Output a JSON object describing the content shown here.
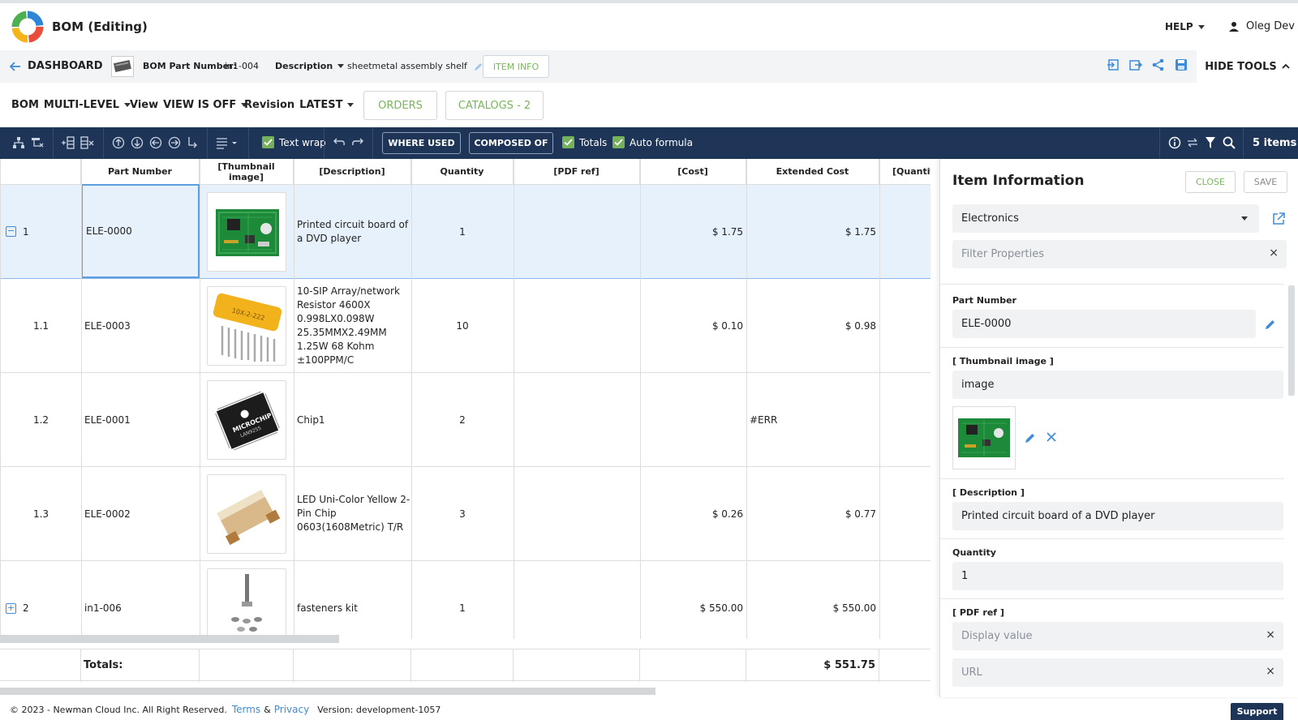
{
  "app": {
    "title": "BOM (Editing)",
    "help_label": "HELP",
    "user_name": "Oleg Dev"
  },
  "nav": {
    "dashboard_label": "DASHBOARD",
    "bom_part_number_label": "BOM Part Number:",
    "bom_part_number_value": "in1-004",
    "description_label": "Description",
    "description_value": "sheetmetal assembly shelf",
    "item_info_label": "ITEM INFO",
    "hide_tools_label": "HIDE TOOLS"
  },
  "options": {
    "bom_label": "BOM",
    "bom_value": "MULTI-LEVEL",
    "view_label": "View",
    "view_value": "VIEW IS OFF",
    "revision_label": "Revision",
    "revision_value": "LATEST",
    "orders_label": "ORDERS",
    "catalogs_label": "CATALOGS - 2"
  },
  "toolbar": {
    "text_wrap_label": "Text wrap",
    "where_used_label": "WHERE USED",
    "composed_of_label": "COMPOSED OF",
    "totals_label": "Totals",
    "auto_formula_label": "Auto formula",
    "items_count": "5 items"
  },
  "table": {
    "columns": [
      "Part Number",
      "[Thumbnail image]",
      "[Description]",
      "Quantity",
      "[PDF ref]",
      "[Cost]",
      "Extended Cost",
      "[Quantity"
    ],
    "rows": [
      {
        "level": "1",
        "expandable": true,
        "part_number": "ELE-0000",
        "description": "Printed circuit board of a DVD player",
        "quantity": "1",
        "pdf_ref": "",
        "cost": "$ 1.75",
        "extended_cost": "$ 1.75",
        "thumb": "pcb"
      },
      {
        "level": "1.1",
        "expandable": false,
        "part_number": "ELE-0003",
        "description": "10-SIP Array/network Resistor 4600X 0.998LX0.098W 25.35MMX2.49MM 1.25W 68 Kohm ±100PPM/C",
        "quantity": "10",
        "pdf_ref": "",
        "cost": "$ 0.10",
        "extended_cost": "$ 0.98",
        "thumb": "resistor"
      },
      {
        "level": "1.2",
        "expandable": false,
        "part_number": "ELE-0001",
        "description": "Chip1",
        "quantity": "2",
        "pdf_ref": "",
        "cost": "",
        "extended_cost": "#ERR",
        "thumb": "chip"
      },
      {
        "level": "1.3",
        "expandable": false,
        "part_number": "ELE-0002",
        "description": "LED Uni-Color Yellow 2-Pin Chip 0603(1608Metric) T/R",
        "quantity": "3",
        "pdf_ref": "",
        "cost": "$ 0.26",
        "extended_cost": "$ 0.77",
        "thumb": "led"
      },
      {
        "level": "2",
        "expandable": true,
        "part_number": "in1-006",
        "description": "fasteners kit",
        "quantity": "1",
        "pdf_ref": "",
        "cost": "$ 550.00",
        "extended_cost": "$ 550.00",
        "thumb": "fasteners"
      }
    ],
    "totals_label": "Totals:",
    "totals_value": "$ 551.75"
  },
  "panel": {
    "title": "Item Information",
    "close_label": "CLOSE",
    "save_label": "SAVE",
    "category_value": "Electronics",
    "filter_placeholder": "Filter Properties",
    "part_number_label": "Part Number",
    "part_number_value": "ELE-0000",
    "thumbnail_label": "[ Thumbnail image ]",
    "thumbnail_value": "image",
    "description_label": "[ Description ]",
    "description_value": "Printed circuit board of a DVD player",
    "quantity_label": "Quantity",
    "quantity_value": "1",
    "pdf_ref_label": "[ PDF ref ]",
    "display_value_placeholder": "Display value",
    "url_placeholder": "URL"
  },
  "footer": {
    "copyright": "© 2023 - Newman Cloud Inc. All Right Reserved.",
    "terms_label": "Terms",
    "amp": "&",
    "privacy_label": "Privacy",
    "version": "Version: development-1057",
    "support_label": "Support"
  },
  "colors": {
    "navy": "#1e3557",
    "accent_green": "#7ab55c",
    "link_blue": "#3d8bd9",
    "selected_row": "#e7f1fb"
  }
}
